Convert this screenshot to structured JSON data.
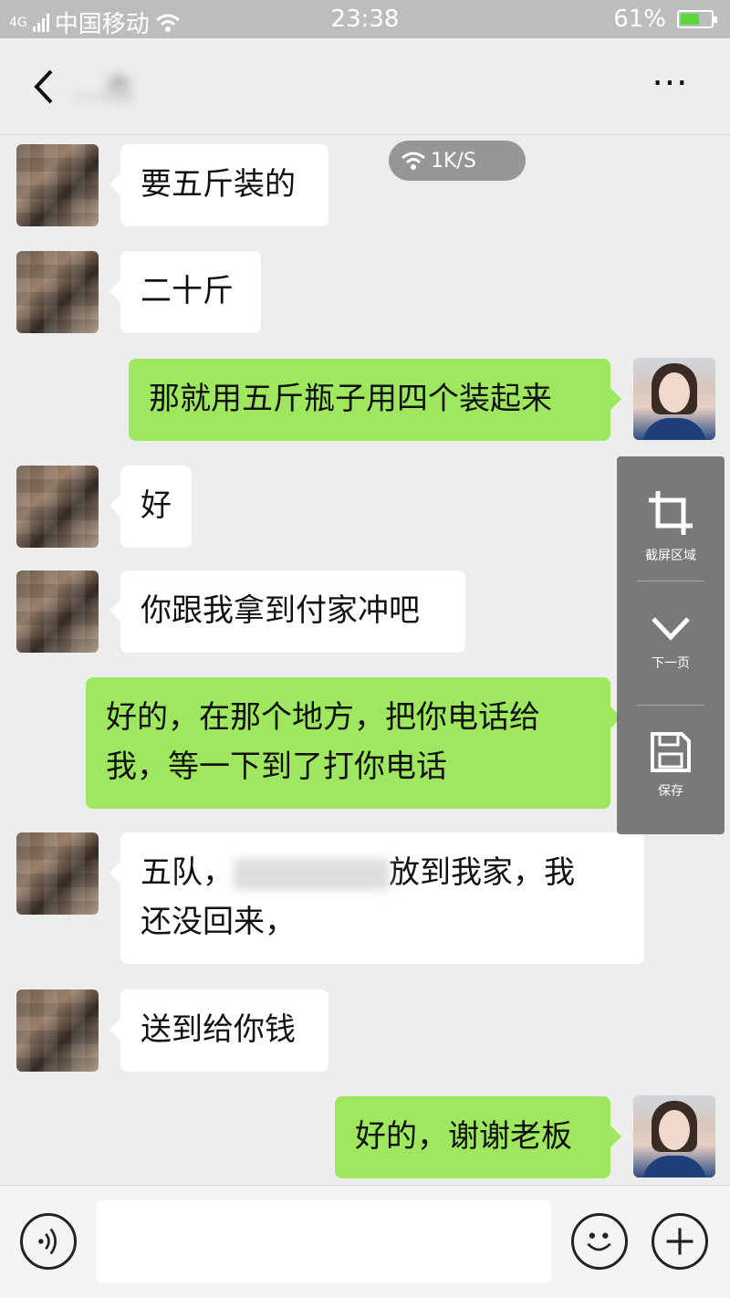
{
  "status_bar": {
    "network": "4G",
    "carrier": "中国移动",
    "time": "23:38",
    "battery": "61%",
    "battery_level": 0.61
  },
  "header": {
    "contact_name": "…杰",
    "more_label": "⋯"
  },
  "speed_indicator": "1K/S",
  "messages": [
    {
      "from": "them",
      "text": "要五斤装的"
    },
    {
      "from": "them",
      "text": "二十斤"
    },
    {
      "from": "me",
      "text": "那就用五斤瓶子用四个装起来"
    },
    {
      "from": "them",
      "text": "好"
    },
    {
      "from": "them",
      "text": "你跟我拿到付家冲吧"
    },
    {
      "from": "me",
      "line1": "好的，在那个地方，把你电话给",
      "line2": "我，等一下到了打你电话"
    },
    {
      "from": "them",
      "line1a": "五队，",
      "line1b": "放到我家，我",
      "line2": "还没回来，"
    },
    {
      "from": "them",
      "text": "送到给你钱"
    },
    {
      "from": "me",
      "text": "好的，谢谢老板"
    }
  ],
  "float_panel": {
    "crop_label": "截屏区域",
    "next_label": "下一页",
    "save_label": "保存"
  },
  "input": {
    "placeholder": ""
  },
  "colors": {
    "my_bubble": "#9ee75e",
    "their_bubble": "#ffffff",
    "background": "#ededed"
  }
}
